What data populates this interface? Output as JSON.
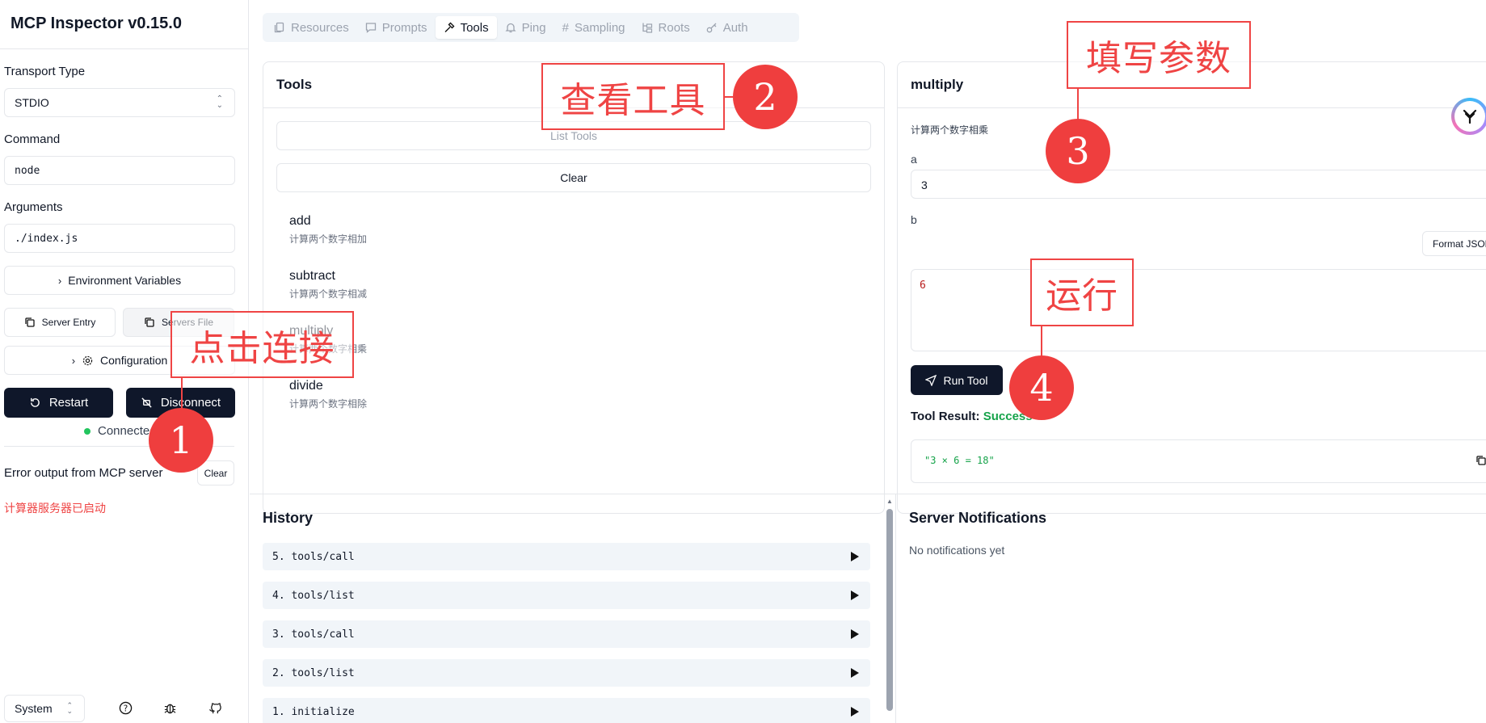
{
  "app": {
    "title": "MCP Inspector v0.15.0"
  },
  "sidebar": {
    "transport_label": "Transport Type",
    "transport_value": "STDIO",
    "command_label": "Command",
    "command_value": "node",
    "arguments_label": "Arguments",
    "arguments_value": "./index.js",
    "env_button": "Environment Variables",
    "server_entry_button": "Server Entry",
    "servers_file_button": "Servers File",
    "configuration_button": "Configuration",
    "restart_button": "Restart",
    "disconnect_button": "Disconnect",
    "status_text": "Connected",
    "error_title": "Error output from MCP server",
    "error_clear": "Clear",
    "error_line": "计算器服务器已启动",
    "theme_value": "System"
  },
  "tabs": [
    {
      "label": "Resources",
      "icon": "files-icon"
    },
    {
      "label": "Prompts",
      "icon": "message-icon"
    },
    {
      "label": "Tools",
      "icon": "hammer-icon"
    },
    {
      "label": "Ping",
      "icon": "bell-icon"
    },
    {
      "label": "Sampling",
      "icon": "hash-icon"
    },
    {
      "label": "Roots",
      "icon": "folder-tree-icon"
    },
    {
      "label": "Auth",
      "icon": "key-icon"
    }
  ],
  "tools_panel": {
    "title": "Tools",
    "list_button": "List Tools",
    "clear_button": "Clear",
    "items": [
      {
        "name": "add",
        "desc": "计算两个数字相加"
      },
      {
        "name": "subtract",
        "desc": "计算两个数字相减"
      },
      {
        "name": "multiply",
        "desc": "计算两个数字相乘"
      },
      {
        "name": "divide",
        "desc": "计算两个数字相除"
      }
    ]
  },
  "tool_detail": {
    "title": "multiply",
    "desc": "计算两个数字相乘",
    "param_a_label": "a",
    "param_a_value": "3",
    "param_b_label": "b",
    "format_json_button": "Format JSON",
    "param_b_value": "6",
    "run_button": "Run Tool",
    "result_label": "Tool Result:",
    "result_status": "Success",
    "result_value": "\"3 × 6 = 18\""
  },
  "history": {
    "title": "History",
    "items": [
      "5. tools/call",
      "4. tools/list",
      "3. tools/call",
      "2. tools/list",
      "1. initialize"
    ]
  },
  "notifications": {
    "title": "Server Notifications",
    "empty_text": "No notifications yet"
  },
  "annotations": [
    {
      "text": "点击连接",
      "number": "1"
    },
    {
      "text": "查看工具",
      "number": "2"
    },
    {
      "text": "填写参数",
      "number": "3"
    },
    {
      "text": "运行",
      "number": "4"
    }
  ],
  "colors": {
    "accent_dark": "#0f172a",
    "success": "#16a34a",
    "error": "#ef4444",
    "annotation": "#ef3e3e"
  }
}
